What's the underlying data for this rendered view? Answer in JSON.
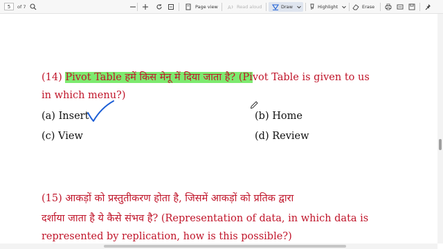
{
  "toolbar": {
    "page_number": "5",
    "page_total": "of 7",
    "page_view_label": "Page view",
    "read_aloud_label": "Read aloud",
    "draw_label": "Draw",
    "highlight_label": "Highlight",
    "erase_label": "Erase"
  },
  "document": {
    "q14": {
      "number": "(14)",
      "highlighted": "Pivot Table हमें किस मेनू में दिया जाता है? (Pi",
      "rest_line1": "vot Table is given to us",
      "line2": "in which menu?)",
      "options": {
        "a": "(a) Insert",
        "b": "(b) Home",
        "c": "(c) View",
        "d": "(d) Review"
      }
    },
    "q15": {
      "line1": "(15) आकड़ों को प्रस्तुतीकरण होता है, जिसमें आकड़ों को प्रतिक द्वारा",
      "line2": "दर्शाया जाता है ये कैसे संभव है? (Representation of data, in which data is",
      "line3": "represented by replication, how is this possible?)"
    }
  },
  "colors": {
    "question_text": "#c0152a",
    "highlight": "#7dea6f",
    "checkmark": "#1d5fd6"
  }
}
